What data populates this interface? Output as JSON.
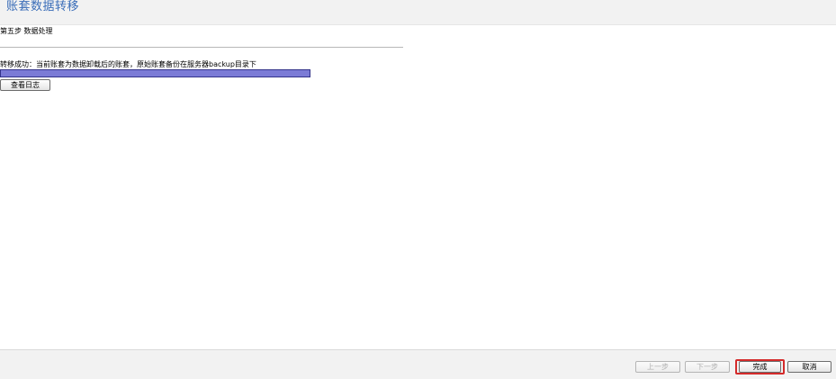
{
  "header": {
    "title": "账套数据转移"
  },
  "step": {
    "label": "第五步 数据处理"
  },
  "result": {
    "status_text": "转移成功：当前账套为数据卸载后的账套，原始账套备份在服务器backup目录下",
    "progress_percent": 100,
    "progress_color": "#7b7bd6",
    "view_log_label": "查看日志"
  },
  "footer": {
    "prev_label": "上一步",
    "next_label": "下一步",
    "finish_label": "完成",
    "cancel_label": "取消",
    "highlight_color": "#d42a2a"
  }
}
